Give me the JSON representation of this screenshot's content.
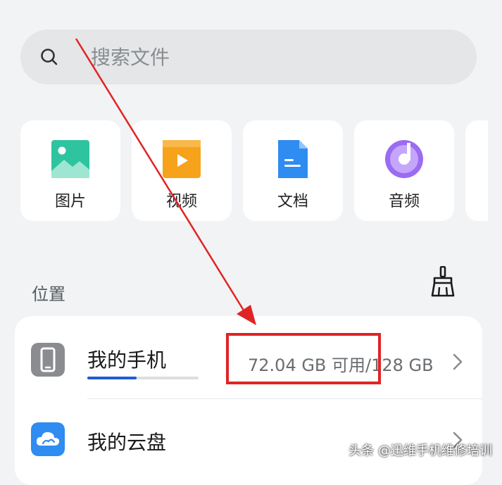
{
  "search": {
    "placeholder": "搜索文件",
    "icon": "search-icon"
  },
  "categories": [
    {
      "label": "图片",
      "icon": "image-icon",
      "color": "#2ec4a0"
    },
    {
      "label": "视频",
      "icon": "video-icon",
      "color": "#f7a21b"
    },
    {
      "label": "文档",
      "icon": "document-icon",
      "color": "#2f8cf0"
    },
    {
      "label": "音频",
      "icon": "audio-icon",
      "color": "#9b6cf2"
    }
  ],
  "locations": {
    "title": "位置",
    "clean_icon": "broom-icon",
    "items": [
      {
        "label": "我的手机",
        "storage": "72.04 GB 可用/128 GB",
        "icon": "phone-icon",
        "used_fraction": 0.44,
        "bar_color": "#1e5bd8"
      },
      {
        "label": "我的云盘",
        "icon": "cloud-icon",
        "color": "#2f8cf0"
      }
    ]
  },
  "watermark": "头条 @迅维手机维修培训",
  "highlight_color": "#e02424"
}
